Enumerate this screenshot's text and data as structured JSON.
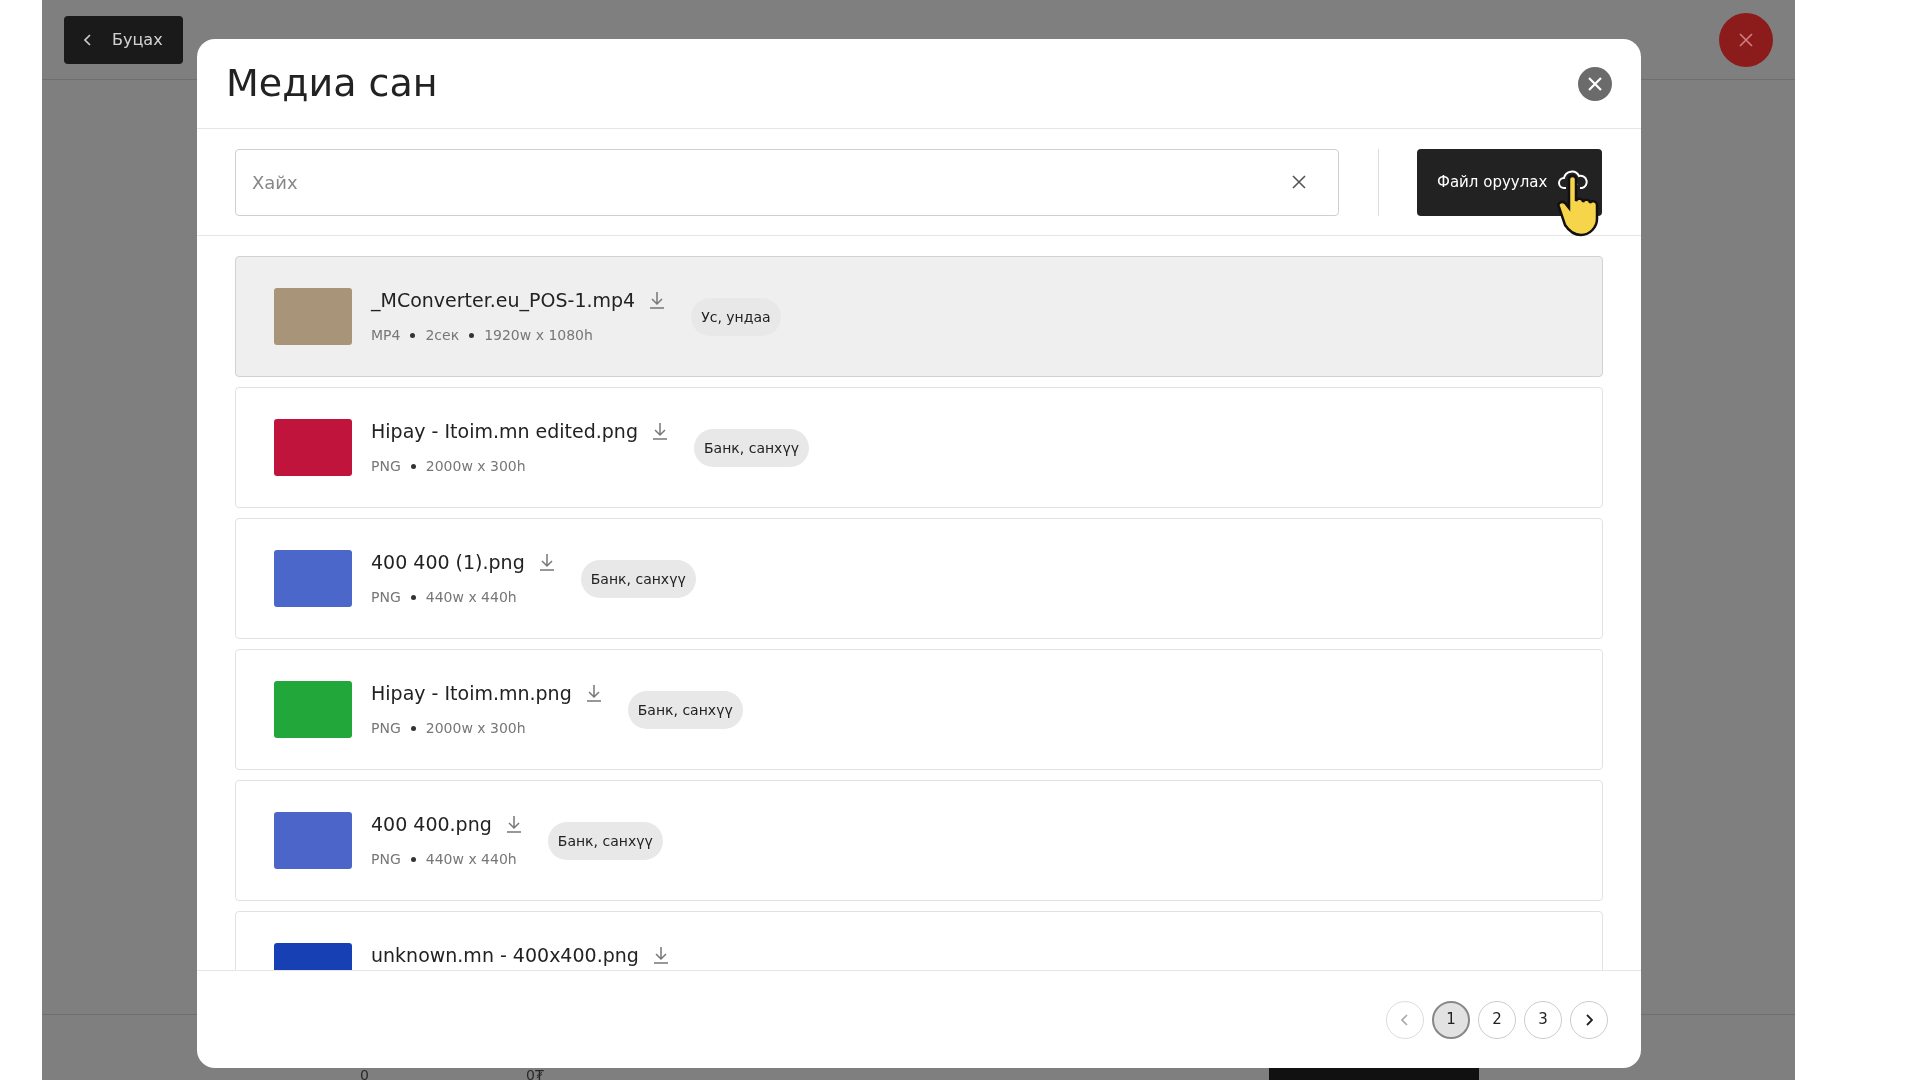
{
  "background_page": {
    "back_button": "Буцах",
    "footer_values": [
      "0",
      "0₮"
    ]
  },
  "modal": {
    "title": "Медиа сан",
    "search": {
      "placeholder": "Хайх"
    },
    "upload_button": "Файл оруулах",
    "files": [
      {
        "name": "_MConverter.eu_POS-1.mp4",
        "meta": [
          "MP4",
          "2сек",
          "1920w x 1080h"
        ],
        "tag": "Ус, ундаа",
        "selected": true,
        "color": "#a89478"
      },
      {
        "name": "Hipay - Itoim.mn edited.png",
        "meta": [
          "PNG",
          "2000w x 300h"
        ],
        "tag": "Банк, санхүү",
        "selected": false,
        "color": "#c0143c"
      },
      {
        "name": "400 400 (1).png",
        "meta": [
          "PNG",
          "440w x 440h"
        ],
        "tag": "Банк, санхүү",
        "selected": false,
        "color": "#4a67c9"
      },
      {
        "name": "Hipay - Itoim.mn.png",
        "meta": [
          "PNG",
          "2000w x 300h"
        ],
        "tag": "Банк, санхүү",
        "selected": false,
        "color": "#22a83a"
      },
      {
        "name": "400 400.png",
        "meta": [
          "PNG",
          "440w x 440h"
        ],
        "tag": "Банк, санхүү",
        "selected": false,
        "color": "#4b66c8"
      },
      {
        "name": "unknown.mn - 400x400.png",
        "selected": false,
        "color": "#1740b5"
      }
    ],
    "pagination": {
      "pages": [
        {
          "label": "1",
          "selected": true
        },
        {
          "label": "2",
          "selected": false
        },
        {
          "label": "3",
          "selected": false
        }
      ]
    }
  }
}
